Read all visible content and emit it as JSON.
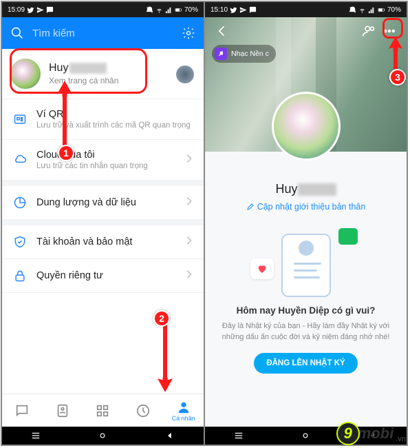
{
  "status": {
    "time": "15:09",
    "time2": "15:10",
    "battery": "70%"
  },
  "screen1": {
    "search_placeholder": "Tìm kiếm",
    "profile": {
      "name": "Huy",
      "sub": "Xem trang cá nhân"
    },
    "items": [
      {
        "icon": "qr",
        "label": "Ví QR",
        "desc": "Lưu trữ và xuất trình các mã QR quan trọng",
        "chev": false
      },
      {
        "icon": "cloud",
        "label": "Cloud của tôi",
        "desc": "Lưu trữ các tin nhắn quan trọng",
        "chev": true
      },
      {
        "icon": "pie",
        "label": "Dung lượng và dữ liệu",
        "desc": "",
        "chev": true
      },
      {
        "icon": "shield",
        "label": "Tài khoản và bảo mật",
        "desc": "",
        "chev": true
      },
      {
        "icon": "lock",
        "label": "Quyền riêng tư",
        "desc": "",
        "chev": true
      }
    ],
    "tabs": {
      "active_label": "Cá nhân"
    }
  },
  "screen2": {
    "music": "Nhạc Nền c",
    "name": "Huy",
    "update_intro": "Cập nhật giới thiệu bản thân",
    "diary_title": "Hôm nay Huyền Diệp có gì vui?",
    "diary_sub": "Đây là Nhật ký của bạn - Hãy làm đầy Nhật ký với những dấu ấn cuộc đời và kỷ niệm đáng nhớ nhé!",
    "diary_btn": "ĐĂNG LÊN NHẬT KÝ"
  },
  "watermark": {
    "nine": "9",
    "text": "mobi",
    "vn": ".vn"
  },
  "markers": {
    "m1": "1",
    "m2": "2",
    "m3": "3"
  }
}
